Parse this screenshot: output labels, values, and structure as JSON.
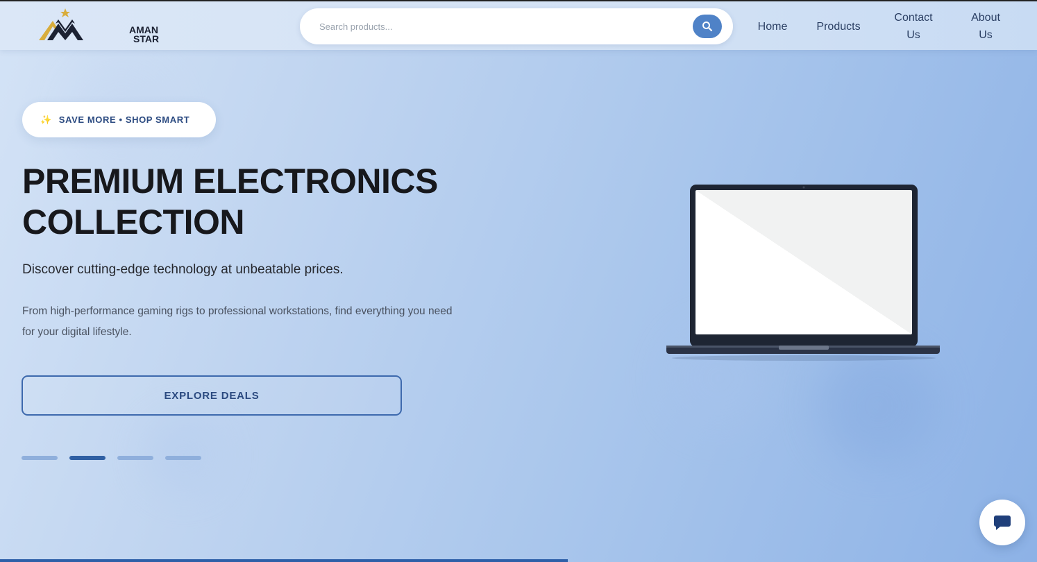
{
  "brand": {
    "name_line1": "AMAN",
    "name_line2": "STAR",
    "logo_icon": "mountain-star-logo",
    "colors": {
      "gold": "#d8ad3c",
      "navy": "#1c2233"
    }
  },
  "search": {
    "placeholder": "Search products...",
    "value": "",
    "icon": "search-icon"
  },
  "nav": {
    "home": "Home",
    "products": "Products",
    "contact_line1": "Contact",
    "contact_line2": "Us",
    "about_line1": "About",
    "about_line2": "Us"
  },
  "hero": {
    "badge_icon": "sparkle-icon",
    "badge": "SAVE MORE • SHOP SMART",
    "title_line1": "PREMIUM ELECTRONICS",
    "title_line2": "COLLECTION",
    "subtitle": "Discover cutting-edge technology at unbeatable prices.",
    "description_line1": "From high-performance gaming rigs to professional workstations, find everything you need",
    "description_line2": "for your digital lifestyle.",
    "cta": "EXPLORE DEALS",
    "image": "laptop-illustration",
    "slides_total": 4,
    "active_slide": 2
  },
  "chat": {
    "icon": "chat-bubble-icon"
  },
  "accent_colors": {
    "primary": "#2d5fa8",
    "button": "#4f82c7"
  }
}
